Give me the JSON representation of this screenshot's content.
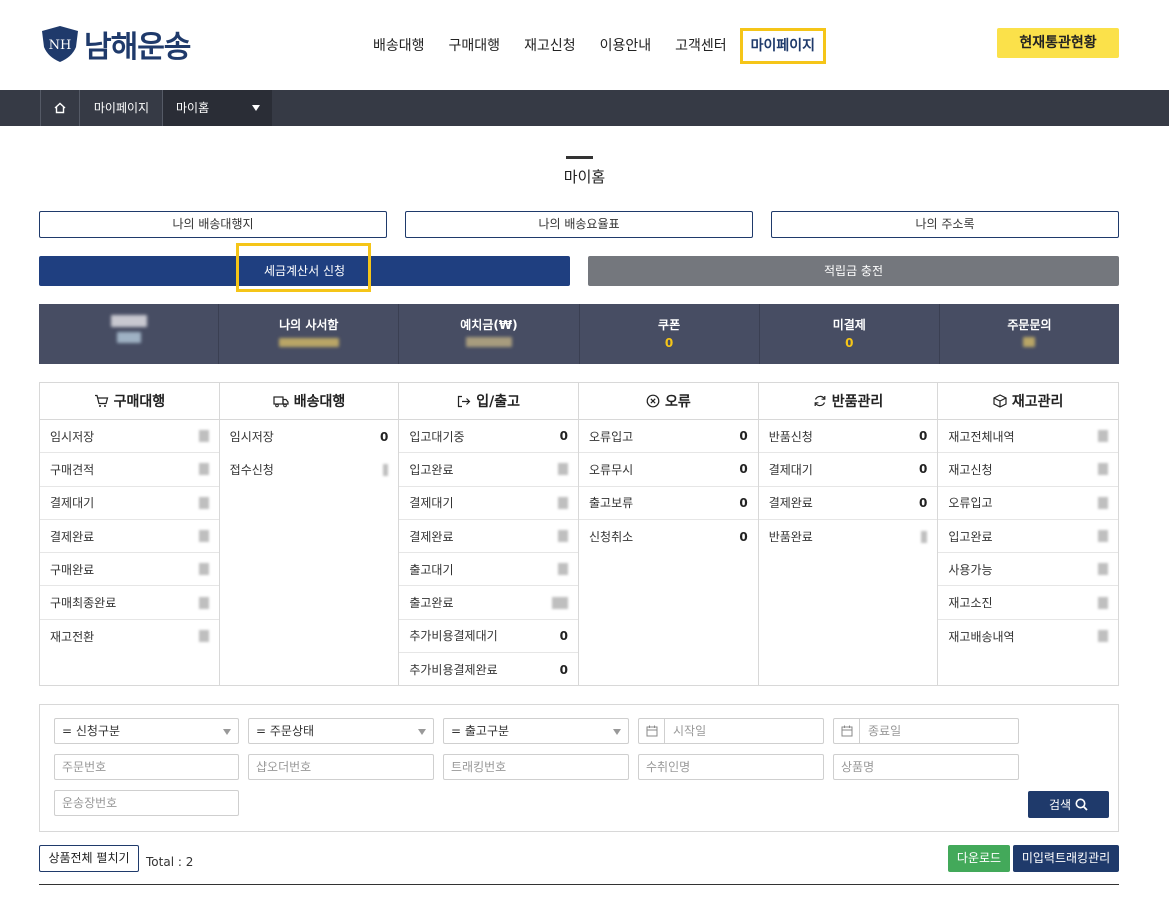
{
  "brand": {
    "name": "남해운송",
    "logo_mark": "NH",
    "accent": "#1f3a6b",
    "highlight": "#f5c518"
  },
  "nav": {
    "items": [
      {
        "label": "배송대행"
      },
      {
        "label": "구매대행"
      },
      {
        "label": "재고신청"
      },
      {
        "label": "이용안내"
      },
      {
        "label": "고객센터"
      },
      {
        "label": "마이페이지"
      }
    ],
    "active_index": 5,
    "customs_button": "현재통관현황"
  },
  "breadcrumb": {
    "home_icon": "home-icon",
    "item": "마이페이지",
    "selected": "마이홈"
  },
  "page": {
    "title": "마이홈"
  },
  "quick_links": {
    "shipping_form": "나의 배송대행지",
    "shipping_rates": "나의 배송요율표",
    "address_book": "나의 주소록",
    "tax_invoice": "세금계산서 신청",
    "points_charge": "적립금 충전"
  },
  "stats": [
    {
      "label": "",
      "value": ""
    },
    {
      "label": "나의 사서함",
      "value": ""
    },
    {
      "label": "예치금(₩)",
      "value": ""
    },
    {
      "label": "쿠폰",
      "value": "0"
    },
    {
      "label": "미결제",
      "value": "0"
    },
    {
      "label": "주문문의",
      "value": ""
    }
  ],
  "categories": [
    {
      "title": "구매대행",
      "icon": "cart-icon",
      "rows": [
        {
          "label": "임시저장",
          "value": ""
        },
        {
          "label": "구매견적",
          "value": ""
        },
        {
          "label": "결제대기",
          "value": ""
        },
        {
          "label": "결제완료",
          "value": ""
        },
        {
          "label": "구매완료",
          "value": ""
        },
        {
          "label": "구매최종완료",
          "value": ""
        },
        {
          "label": "재고전환",
          "value": ""
        }
      ]
    },
    {
      "title": "배송대행",
      "icon": "truck-icon",
      "rows": [
        {
          "label": "임시저장",
          "value": "0"
        },
        {
          "label": "접수신청",
          "value": ""
        }
      ]
    },
    {
      "title": "입/출고",
      "icon": "sign-in-icon",
      "rows": [
        {
          "label": "입고대기중",
          "value": "0"
        },
        {
          "label": "입고완료",
          "value": ""
        },
        {
          "label": "결제대기",
          "value": ""
        },
        {
          "label": "결제완료",
          "value": ""
        },
        {
          "label": "출고대기",
          "value": ""
        },
        {
          "label": "출고완료",
          "value": ""
        },
        {
          "label": "추가비용결제대기",
          "value": "0"
        },
        {
          "label": "추가비용결제완료",
          "value": "0"
        }
      ]
    },
    {
      "title": "오류",
      "icon": "error-circle-icon",
      "rows": [
        {
          "label": "오류입고",
          "value": "0"
        },
        {
          "label": "오류무시",
          "value": "0"
        },
        {
          "label": "출고보류",
          "value": "0"
        },
        {
          "label": "신청취소",
          "value": "0"
        }
      ]
    },
    {
      "title": "반품관리",
      "icon": "refresh-icon",
      "rows": [
        {
          "label": "반품신청",
          "value": "0"
        },
        {
          "label": "결제대기",
          "value": "0"
        },
        {
          "label": "결제완료",
          "value": "0"
        },
        {
          "label": "반품완료",
          "value": ""
        }
      ]
    },
    {
      "title": "재고관리",
      "icon": "box-icon",
      "rows": [
        {
          "label": "재고전체내역",
          "value": ""
        },
        {
          "label": "재고신청",
          "value": ""
        },
        {
          "label": "오류입고",
          "value": ""
        },
        {
          "label": "입고완료",
          "value": ""
        },
        {
          "label": "사용가능",
          "value": ""
        },
        {
          "label": "재고소진",
          "value": ""
        },
        {
          "label": "재고배송내역",
          "value": ""
        }
      ]
    }
  ],
  "search": {
    "request_type": "= 신청구분",
    "order_status": "= 주문상태",
    "release_type": "= 출고구분",
    "start_date_placeholder": "시작일",
    "end_date_placeholder": "종료일",
    "order_no_placeholder": "주문번호",
    "shop_order_placeholder": "샵오더번호",
    "tracking_placeholder": "트래킹번호",
    "recipient_placeholder": "수취인명",
    "product_placeholder": "상품명",
    "waybill_placeholder": "운송장번호",
    "search_button": "검색"
  },
  "toolbar": {
    "expand_all": "상품전체 펼치기",
    "total": "Total : 2",
    "download": "다운로드",
    "untracked": "미입력트래킹관리"
  }
}
